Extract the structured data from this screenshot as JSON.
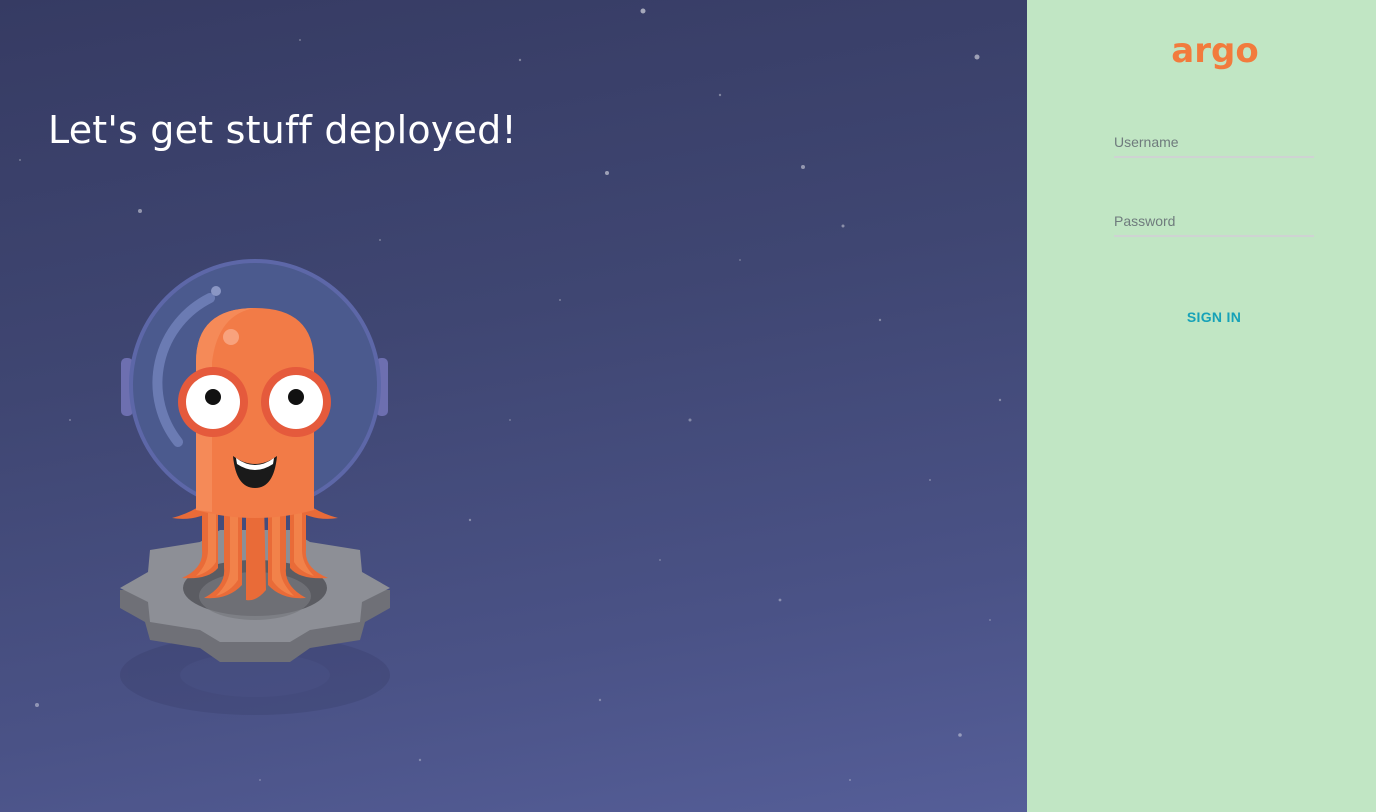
{
  "hero": {
    "title": "Let's get stuff deployed!",
    "mascot_icon": "argo-octopus-astronaut-icon",
    "background_colors": [
      "#363b63",
      "#555e98"
    ]
  },
  "login": {
    "logo_text": "argo",
    "logo_color": "#f27b3d",
    "panel_color": "#c1e6c4",
    "username_placeholder": "Username",
    "password_placeholder": "Password",
    "sign_in_label": "SIGN IN",
    "accent_color": "#16a2b8"
  }
}
